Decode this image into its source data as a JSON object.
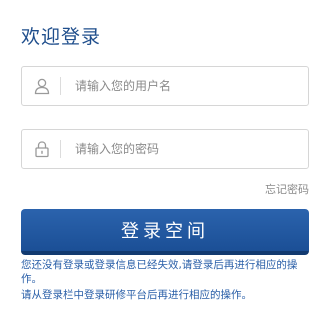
{
  "header": {
    "title": "欢迎登录"
  },
  "form": {
    "username": {
      "placeholder": "请输入您的用户名",
      "value": "",
      "icon": "user-icon"
    },
    "password": {
      "placeholder": "请输入您的密码",
      "value": "",
      "icon": "lock-icon"
    },
    "forgot_label": "忘记密码",
    "submit_label": "登录空间"
  },
  "notes": {
    "line1": "您还没有登录或登录信息已经失效,请登录后再进行相应的操作。",
    "line2": "请从登录栏中登录研修平台后再进行相应的操作。"
  },
  "colors": {
    "title": "#1f4e8c",
    "button": "#1b4f96",
    "note": "#2a5fa8"
  }
}
